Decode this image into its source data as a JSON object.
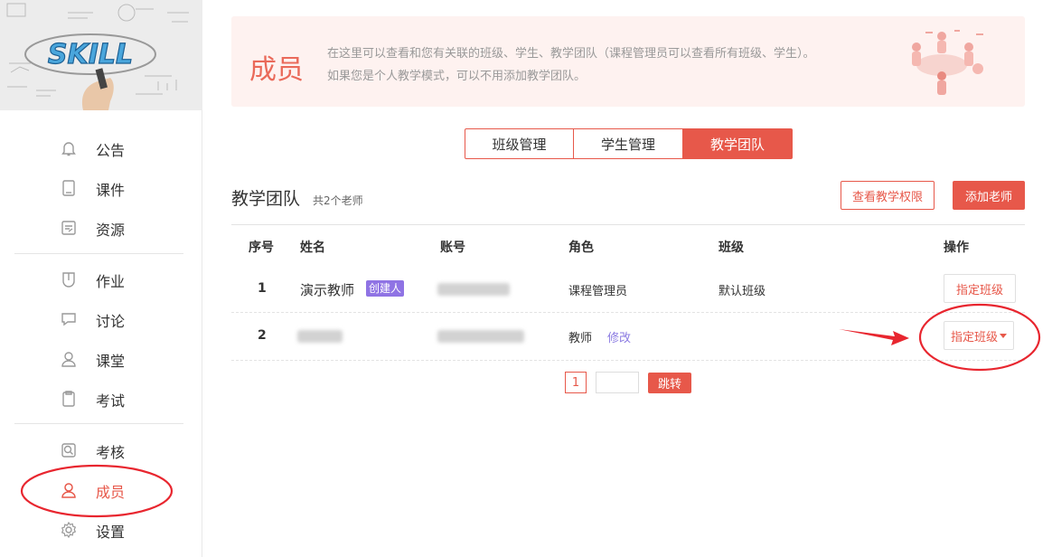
{
  "sidebar": {
    "banner_text": "SKILL",
    "items": [
      {
        "label": "公告",
        "icon": "bell-icon"
      },
      {
        "label": "课件",
        "icon": "book-icon"
      },
      {
        "label": "资源",
        "icon": "folder-icon"
      },
      {
        "label": "作业",
        "icon": "homework-icon"
      },
      {
        "label": "讨论",
        "icon": "chat-icon"
      },
      {
        "label": "课堂",
        "icon": "user-icon"
      },
      {
        "label": "考试",
        "icon": "exam-icon"
      },
      {
        "label": "考核",
        "icon": "assessment-icon"
      },
      {
        "label": "成员",
        "icon": "member-icon"
      },
      {
        "label": "设置",
        "icon": "gear-icon"
      }
    ],
    "active": "成员"
  },
  "header": {
    "title": "成员",
    "desc1": "在这里可以查看和您有关联的班级、学生、教学团队（课程管理员可以查看所有班级、学生）。",
    "desc2": "如果您是个人教学模式，可以不用添加教学团队。"
  },
  "tabs": [
    "班级管理",
    "学生管理",
    "教学团队"
  ],
  "active_tab": "教学团队",
  "section": {
    "title": "教学团队",
    "count": "共2个老师",
    "view_permissions": "查看教学权限",
    "add_teacher": "添加老师"
  },
  "table": {
    "headers": [
      "序号",
      "姓名",
      "账号",
      "角色",
      "班级",
      "操作"
    ],
    "rows": [
      {
        "index": "1",
        "name": "演示教师",
        "badge": "创建人",
        "role": "课程管理员",
        "class": "默认班级",
        "action": "指定班级"
      },
      {
        "index": "2",
        "name": "",
        "role": "教师",
        "edit": "修改",
        "class": "",
        "action": "指定班级"
      }
    ]
  },
  "pagination": {
    "page": "1",
    "go": "跳转"
  },
  "colors": {
    "accent": "#e7584a",
    "badge": "#8f73e4",
    "header_bg": "#fef2f0",
    "annotation": "#e8262f"
  }
}
